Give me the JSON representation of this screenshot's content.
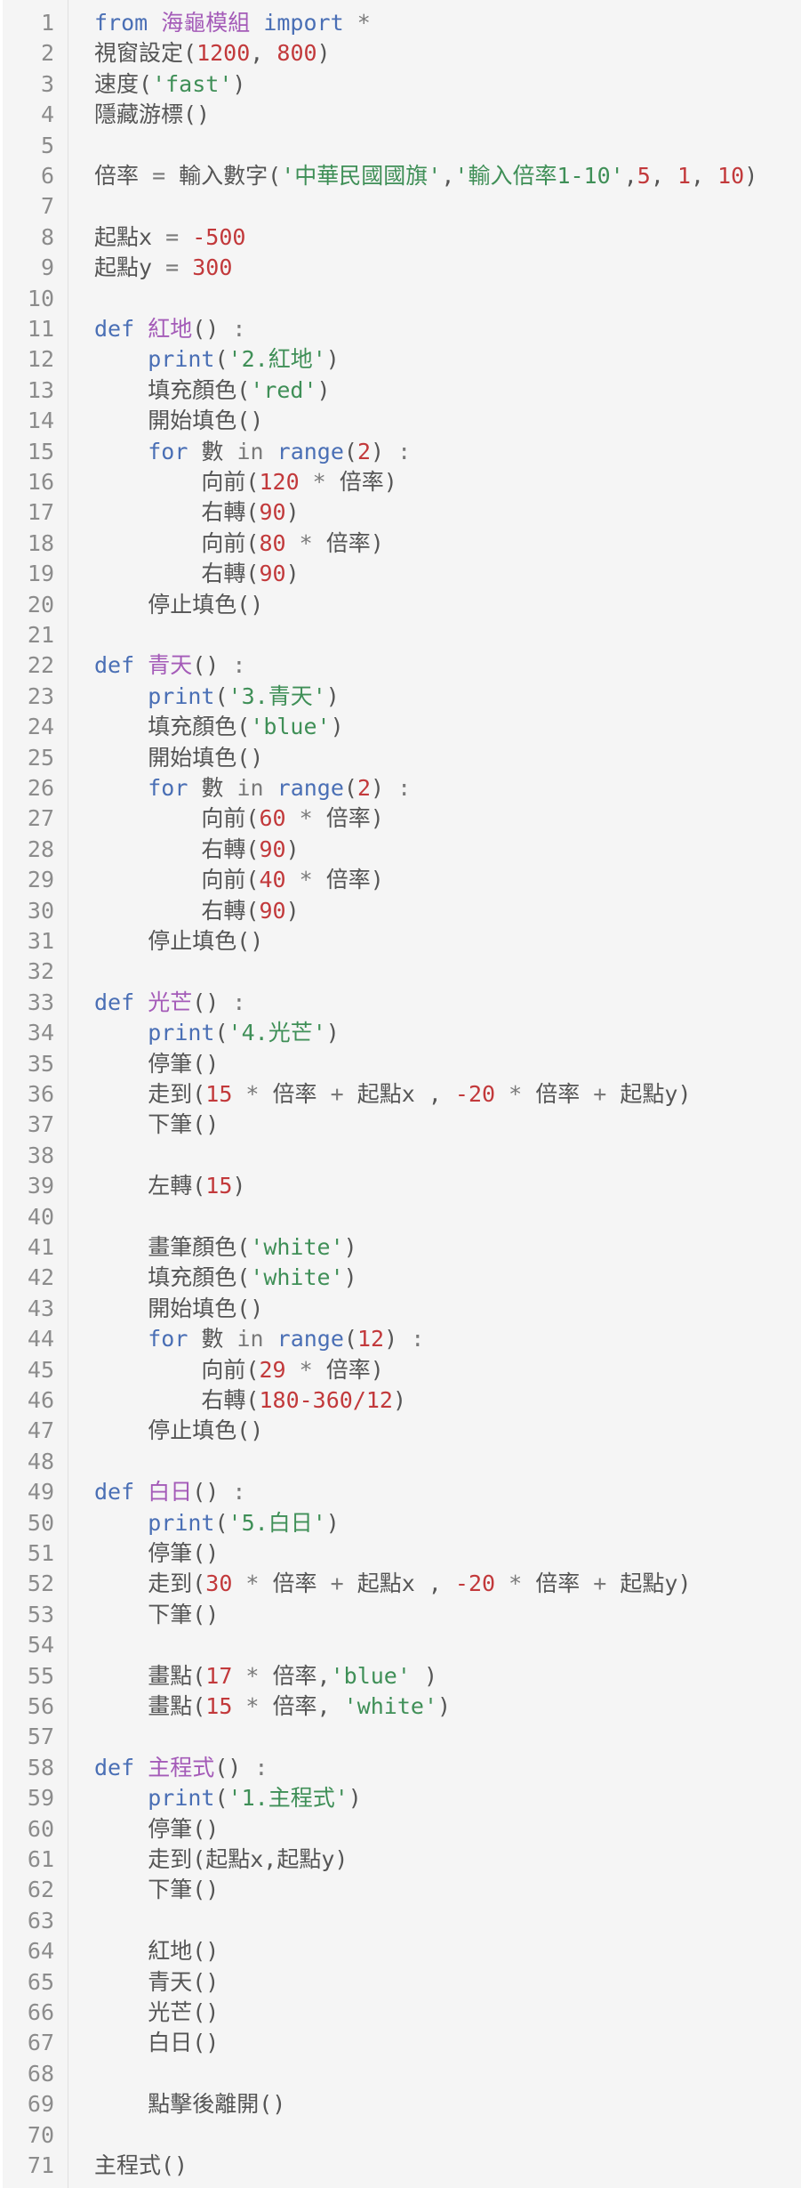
{
  "colors": {
    "keyword": "#4a6fb5",
    "func": "#a45bb8",
    "string": "#3f8f57",
    "number": "#c2393b",
    "operator": "#7a7a7a",
    "text": "#555555",
    "line_number": "#8c8c8c",
    "background": "#f5f5f5"
  },
  "lines": [
    {
      "n": "1",
      "t": [
        [
          "keyword",
          "from "
        ],
        [
          "func",
          "海龜模組"
        ],
        [
          "keyword",
          " import"
        ],
        [
          "operator",
          " *"
        ]
      ]
    },
    {
      "n": "2",
      "t": [
        [
          "text",
          "視窗設定("
        ],
        [
          "number",
          "1200"
        ],
        [
          "text",
          ", "
        ],
        [
          "number",
          "800"
        ],
        [
          "text",
          ")"
        ]
      ]
    },
    {
      "n": "3",
      "t": [
        [
          "text",
          "速度("
        ],
        [
          "string",
          "'fast'"
        ],
        [
          "text",
          ")"
        ]
      ]
    },
    {
      "n": "4",
      "t": [
        [
          "text",
          "隱藏游標()"
        ]
      ]
    },
    {
      "n": "5",
      "t": []
    },
    {
      "n": "6",
      "t": [
        [
          "text",
          "倍率 "
        ],
        [
          "operator",
          "= "
        ],
        [
          "text",
          "輸入數字("
        ],
        [
          "string",
          "'中華民國國旗'"
        ],
        [
          "text",
          ","
        ],
        [
          "string",
          "'輸入倍率1-10'"
        ],
        [
          "text",
          ","
        ],
        [
          "number",
          "5"
        ],
        [
          "text",
          ", "
        ],
        [
          "number",
          "1"
        ],
        [
          "text",
          ", "
        ],
        [
          "number",
          "10"
        ],
        [
          "text",
          ")"
        ]
      ]
    },
    {
      "n": "7",
      "t": []
    },
    {
      "n": "8",
      "t": [
        [
          "text",
          "起點x "
        ],
        [
          "operator",
          "= "
        ],
        [
          "number",
          "-500"
        ]
      ]
    },
    {
      "n": "9",
      "t": [
        [
          "text",
          "起點y "
        ],
        [
          "operator",
          "= "
        ],
        [
          "number",
          "300"
        ]
      ]
    },
    {
      "n": "10",
      "t": []
    },
    {
      "n": "11",
      "t": [
        [
          "keyword",
          "def "
        ],
        [
          "func",
          "紅地"
        ],
        [
          "text",
          "() "
        ],
        [
          "operator",
          ":"
        ]
      ]
    },
    {
      "n": "12",
      "t": [
        [
          "text",
          "    "
        ],
        [
          "keyword",
          "print"
        ],
        [
          "text",
          "("
        ],
        [
          "string",
          "'2.紅地'"
        ],
        [
          "text",
          ")"
        ]
      ]
    },
    {
      "n": "13",
      "t": [
        [
          "text",
          "    填充顏色("
        ],
        [
          "string",
          "'red'"
        ],
        [
          "text",
          ")"
        ]
      ]
    },
    {
      "n": "14",
      "t": [
        [
          "text",
          "    開始填色()"
        ]
      ]
    },
    {
      "n": "15",
      "t": [
        [
          "text",
          "    "
        ],
        [
          "keyword",
          "for"
        ],
        [
          "text",
          " 數 "
        ],
        [
          "operator",
          "in"
        ],
        [
          "text",
          " "
        ],
        [
          "keyword",
          "range"
        ],
        [
          "text",
          "("
        ],
        [
          "number",
          "2"
        ],
        [
          "text",
          ") "
        ],
        [
          "operator",
          ":"
        ]
      ]
    },
    {
      "n": "16",
      "t": [
        [
          "text",
          "        向前("
        ],
        [
          "number",
          "120"
        ],
        [
          "operator",
          " * "
        ],
        [
          "text",
          "倍率)"
        ]
      ]
    },
    {
      "n": "17",
      "t": [
        [
          "text",
          "        右轉("
        ],
        [
          "number",
          "90"
        ],
        [
          "text",
          ")"
        ]
      ]
    },
    {
      "n": "18",
      "t": [
        [
          "text",
          "        向前("
        ],
        [
          "number",
          "80"
        ],
        [
          "operator",
          " * "
        ],
        [
          "text",
          "倍率)"
        ]
      ]
    },
    {
      "n": "19",
      "t": [
        [
          "text",
          "        右轉("
        ],
        [
          "number",
          "90"
        ],
        [
          "text",
          ")"
        ]
      ]
    },
    {
      "n": "20",
      "t": [
        [
          "text",
          "    停止填色()"
        ]
      ]
    },
    {
      "n": "21",
      "t": []
    },
    {
      "n": "22",
      "t": [
        [
          "keyword",
          "def "
        ],
        [
          "func",
          "青天"
        ],
        [
          "text",
          "() "
        ],
        [
          "operator",
          ":"
        ]
      ]
    },
    {
      "n": "23",
      "t": [
        [
          "text",
          "    "
        ],
        [
          "keyword",
          "print"
        ],
        [
          "text",
          "("
        ],
        [
          "string",
          "'3.青天'"
        ],
        [
          "text",
          ")"
        ]
      ]
    },
    {
      "n": "24",
      "t": [
        [
          "text",
          "    填充顏色("
        ],
        [
          "string",
          "'blue'"
        ],
        [
          "text",
          ")"
        ]
      ]
    },
    {
      "n": "25",
      "t": [
        [
          "text",
          "    開始填色()"
        ]
      ]
    },
    {
      "n": "26",
      "t": [
        [
          "text",
          "    "
        ],
        [
          "keyword",
          "for"
        ],
        [
          "text",
          " 數 "
        ],
        [
          "operator",
          "in"
        ],
        [
          "text",
          " "
        ],
        [
          "keyword",
          "range"
        ],
        [
          "text",
          "("
        ],
        [
          "number",
          "2"
        ],
        [
          "text",
          ") "
        ],
        [
          "operator",
          ":"
        ]
      ]
    },
    {
      "n": "27",
      "t": [
        [
          "text",
          "        向前("
        ],
        [
          "number",
          "60"
        ],
        [
          "operator",
          " * "
        ],
        [
          "text",
          "倍率)"
        ]
      ]
    },
    {
      "n": "28",
      "t": [
        [
          "text",
          "        右轉("
        ],
        [
          "number",
          "90"
        ],
        [
          "text",
          ")"
        ]
      ]
    },
    {
      "n": "29",
      "t": [
        [
          "text",
          "        向前("
        ],
        [
          "number",
          "40"
        ],
        [
          "operator",
          " * "
        ],
        [
          "text",
          "倍率)"
        ]
      ]
    },
    {
      "n": "30",
      "t": [
        [
          "text",
          "        右轉("
        ],
        [
          "number",
          "90"
        ],
        [
          "text",
          ")"
        ]
      ]
    },
    {
      "n": "31",
      "t": [
        [
          "text",
          "    停止填色()"
        ]
      ]
    },
    {
      "n": "32",
      "t": []
    },
    {
      "n": "33",
      "t": [
        [
          "keyword",
          "def "
        ],
        [
          "func",
          "光芒"
        ],
        [
          "text",
          "() "
        ],
        [
          "operator",
          ":"
        ]
      ]
    },
    {
      "n": "34",
      "t": [
        [
          "text",
          "    "
        ],
        [
          "keyword",
          "print"
        ],
        [
          "text",
          "("
        ],
        [
          "string",
          "'4.光芒'"
        ],
        [
          "text",
          ")"
        ]
      ]
    },
    {
      "n": "35",
      "t": [
        [
          "text",
          "    停筆()"
        ]
      ]
    },
    {
      "n": "36",
      "t": [
        [
          "text",
          "    走到("
        ],
        [
          "number",
          "15"
        ],
        [
          "operator",
          " * "
        ],
        [
          "text",
          "倍率 "
        ],
        [
          "operator",
          "+ "
        ],
        [
          "text",
          "起點x , "
        ],
        [
          "number",
          "-20"
        ],
        [
          "operator",
          " * "
        ],
        [
          "text",
          "倍率 "
        ],
        [
          "operator",
          "+ "
        ],
        [
          "text",
          "起點y)"
        ]
      ]
    },
    {
      "n": "37",
      "t": [
        [
          "text",
          "    下筆()"
        ]
      ]
    },
    {
      "n": "38",
      "t": []
    },
    {
      "n": "39",
      "t": [
        [
          "text",
          "    左轉("
        ],
        [
          "number",
          "15"
        ],
        [
          "text",
          ")"
        ]
      ]
    },
    {
      "n": "40",
      "t": []
    },
    {
      "n": "41",
      "t": [
        [
          "text",
          "    畫筆顏色("
        ],
        [
          "string",
          "'white'"
        ],
        [
          "text",
          ")"
        ]
      ]
    },
    {
      "n": "42",
      "t": [
        [
          "text",
          "    填充顏色("
        ],
        [
          "string",
          "'white'"
        ],
        [
          "text",
          ")"
        ]
      ]
    },
    {
      "n": "43",
      "t": [
        [
          "text",
          "    開始填色()"
        ]
      ]
    },
    {
      "n": "44",
      "t": [
        [
          "text",
          "    "
        ],
        [
          "keyword",
          "for"
        ],
        [
          "text",
          " 數 "
        ],
        [
          "operator",
          "in"
        ],
        [
          "text",
          " "
        ],
        [
          "keyword",
          "range"
        ],
        [
          "text",
          "("
        ],
        [
          "number",
          "12"
        ],
        [
          "text",
          ") "
        ],
        [
          "operator",
          ":"
        ]
      ]
    },
    {
      "n": "45",
      "t": [
        [
          "text",
          "        向前("
        ],
        [
          "number",
          "29"
        ],
        [
          "operator",
          " * "
        ],
        [
          "text",
          "倍率)"
        ]
      ]
    },
    {
      "n": "46",
      "t": [
        [
          "text",
          "        右轉("
        ],
        [
          "number",
          "180-360/12"
        ],
        [
          "text",
          ")"
        ]
      ]
    },
    {
      "n": "47",
      "t": [
        [
          "text",
          "    停止填色()"
        ]
      ]
    },
    {
      "n": "48",
      "t": []
    },
    {
      "n": "49",
      "t": [
        [
          "keyword",
          "def "
        ],
        [
          "func",
          "白日"
        ],
        [
          "text",
          "() "
        ],
        [
          "operator",
          ":"
        ]
      ]
    },
    {
      "n": "50",
      "t": [
        [
          "text",
          "    "
        ],
        [
          "keyword",
          "print"
        ],
        [
          "text",
          "("
        ],
        [
          "string",
          "'5.白日'"
        ],
        [
          "text",
          ")"
        ]
      ]
    },
    {
      "n": "51",
      "t": [
        [
          "text",
          "    停筆()"
        ]
      ]
    },
    {
      "n": "52",
      "t": [
        [
          "text",
          "    走到("
        ],
        [
          "number",
          "30"
        ],
        [
          "operator",
          " * "
        ],
        [
          "text",
          "倍率 "
        ],
        [
          "operator",
          "+ "
        ],
        [
          "text",
          "起點x , "
        ],
        [
          "number",
          "-20"
        ],
        [
          "operator",
          " * "
        ],
        [
          "text",
          "倍率 "
        ],
        [
          "operator",
          "+ "
        ],
        [
          "text",
          "起點y)"
        ]
      ]
    },
    {
      "n": "53",
      "t": [
        [
          "text",
          "    下筆()"
        ]
      ]
    },
    {
      "n": "54",
      "t": []
    },
    {
      "n": "55",
      "t": [
        [
          "text",
          "    畫點("
        ],
        [
          "number",
          "17"
        ],
        [
          "operator",
          " * "
        ],
        [
          "text",
          "倍率,"
        ],
        [
          "string",
          "'blue'"
        ],
        [
          "text",
          " )"
        ]
      ]
    },
    {
      "n": "56",
      "t": [
        [
          "text",
          "    畫點("
        ],
        [
          "number",
          "15"
        ],
        [
          "operator",
          " * "
        ],
        [
          "text",
          "倍率, "
        ],
        [
          "string",
          "'white'"
        ],
        [
          "text",
          ")"
        ]
      ]
    },
    {
      "n": "57",
      "t": []
    },
    {
      "n": "58",
      "t": [
        [
          "keyword",
          "def "
        ],
        [
          "func",
          "主程式"
        ],
        [
          "text",
          "() "
        ],
        [
          "operator",
          ":"
        ]
      ]
    },
    {
      "n": "59",
      "t": [
        [
          "text",
          "    "
        ],
        [
          "keyword",
          "print"
        ],
        [
          "text",
          "("
        ],
        [
          "string",
          "'1.主程式'"
        ],
        [
          "text",
          ")"
        ]
      ]
    },
    {
      "n": "60",
      "t": [
        [
          "text",
          "    停筆()"
        ]
      ]
    },
    {
      "n": "61",
      "t": [
        [
          "text",
          "    走到(起點x,起點y)"
        ]
      ]
    },
    {
      "n": "62",
      "t": [
        [
          "text",
          "    下筆()"
        ]
      ]
    },
    {
      "n": "63",
      "t": []
    },
    {
      "n": "64",
      "t": [
        [
          "text",
          "    紅地()"
        ]
      ]
    },
    {
      "n": "65",
      "t": [
        [
          "text",
          "    青天()"
        ]
      ]
    },
    {
      "n": "66",
      "t": [
        [
          "text",
          "    光芒()"
        ]
      ]
    },
    {
      "n": "67",
      "t": [
        [
          "text",
          "    白日()"
        ]
      ]
    },
    {
      "n": "68",
      "t": []
    },
    {
      "n": "69",
      "t": [
        [
          "text",
          "    點擊後離開()"
        ]
      ]
    },
    {
      "n": "70",
      "t": []
    },
    {
      "n": "71",
      "t": [
        [
          "text",
          "主程式()"
        ]
      ]
    }
  ]
}
